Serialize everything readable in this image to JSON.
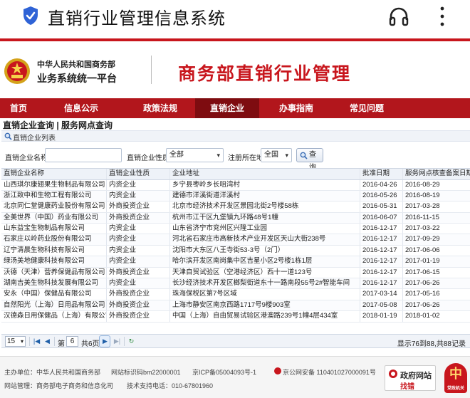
{
  "app": {
    "title": "直销行业管理信息系统"
  },
  "header": {
    "ministry": "中华人民共和国商务部",
    "platform": "业务系统统一平台",
    "main_title": "商务部直销行业管理"
  },
  "nav": {
    "items": [
      {
        "label": "首页",
        "active": false
      },
      {
        "label": "信息公示",
        "active": false
      },
      {
        "label": "政策法规",
        "active": false
      },
      {
        "label": "直销企业",
        "active": true
      },
      {
        "label": "办事指南",
        "active": false
      },
      {
        "label": "常见问题",
        "active": false
      }
    ]
  },
  "breadcrumb": "直销企业查询 | 服务网点查询",
  "subbar": {
    "label": "直销企业列表"
  },
  "search": {
    "name_label": "直销企业名称:",
    "name_value": "",
    "type_label": "直销企业性质:",
    "type_value": "全部",
    "region_label": "注册所在地:",
    "region_value": "全国",
    "query_label": "查询"
  },
  "table": {
    "columns": [
      "直销企业名称",
      "直销企业性质",
      "企业地址",
      "批准日期",
      "服务网点核查备案日期"
    ],
    "rows": [
      [
        "山西琪尔康翅果生物制品有限公司",
        "内资企业",
        "乡宁县枣岭乡长咀湾村",
        "2016-04-26",
        "2016-08-29"
      ],
      [
        "浙江致中和生物工程有限公司",
        "内资企业",
        "建德市洋溪街道洋溪村",
        "2016-05-26",
        "2016-08-19"
      ],
      [
        "北京同仁堂健康药业股份有限公司",
        "外商投资企业",
        "北京市经济技术开发区景园北街2号楼58栋",
        "2016-05-31",
        "2017-03-28"
      ],
      [
        "全美世界（中国）药业有限公司",
        "外商投资企业",
        "杭州市江干区九堡镇九环路48号1幢",
        "2016-06-07",
        "2016-11-15"
      ],
      [
        "山东益宝生物制品有限公司",
        "内资企业",
        "山东省济宁市兖州区兴隆工业园",
        "2016-12-17",
        "2017-03-22"
      ],
      [
        "石家庄以岭药业股份有限公司",
        "内资企业",
        "河北省石家庄市高新技术产业开发区天山大街238号",
        "2016-12-17",
        "2017-09-29"
      ],
      [
        "辽宁清晨生物科技有限公司",
        "内资企业",
        "沈阳市大东区八王寺街53-3号（2门）",
        "2016-12-17",
        "2017-06-06"
      ],
      [
        "绿汤美地健康科技有限公司",
        "内资企业",
        "哈尔滨开发区南岗集中区吉星小区2号楼1栋1层",
        "2016-12-17",
        "2017-01-19"
      ],
      [
        "沃德（天津）营养保健品有限公司",
        "外商投资企业",
        "天津自贸试验区（空港经济区）西十一道123号",
        "2016-12-17",
        "2017-06-15"
      ],
      [
        "湖南吉美生物科技发展有限公司",
        "内资企业",
        "长沙经济技术开发区榔梨街道东十一路南段55号2#智能车间",
        "2016-12-17",
        "2017-06-26"
      ],
      [
        "安永（中国）保健品有限公司",
        "外商投资企业",
        "珠海保税区第7号区域",
        "2017-03-14",
        "2017-05-16"
      ],
      [
        "自然阳光（上海）日用品有限公司",
        "外商投资企业",
        "上海市静安区南京西路1717号9楼903室",
        "2017-05-08",
        "2017-06-26"
      ],
      [
        "汉德森日用保健品（上海）有限公司",
        "外商投资企业",
        "中国（上海）自由贸易试验区港澳路239号1幢4层434室",
        "2018-01-19",
        "2018-01-02"
      ]
    ]
  },
  "pager": {
    "page_size": "15",
    "page_prefix": "第",
    "current_page": "6",
    "total_pages": "共6页",
    "info": "显示76到88,共88记录"
  },
  "footer": {
    "host": "主办单位：中华人民共和国商务部",
    "site_code": "网站标识码bm22000001",
    "icp": "京ICP备05004093号-1",
    "police": "京公网安备 110401027000091号",
    "ops": "网站管理：商务部电子商务和信息化司",
    "tel": "技术支持电话：010-67801960",
    "gov_site_1": "政府网站",
    "gov_site_2": "找错",
    "badge_char": "中",
    "badge_text": "党政机关"
  },
  "colors": {
    "accent": "#c8161d",
    "nav": "#b2161c",
    "nav_active": "#7e0c10",
    "shield": "#2f63d6"
  }
}
